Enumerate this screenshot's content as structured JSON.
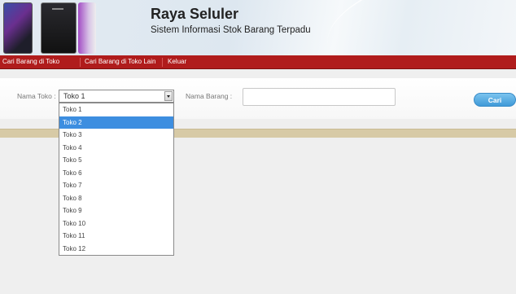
{
  "header": {
    "title": "Raya Seluler",
    "subtitle": "Sistem Informasi Stok Barang Terpadu"
  },
  "nav": {
    "items": [
      "Cari Barang di Toko",
      "Cari Barang di Toko Lain",
      "Keluar"
    ]
  },
  "search": {
    "toko_label": "Nama Toko :",
    "toko_selected": "Toko 1",
    "barang_label": "Nama Barang :",
    "barang_value": "",
    "button_label": "Cari"
  },
  "dropdown": {
    "options": [
      "Toko 1",
      "Toko 2",
      "Toko 3",
      "Toko 4",
      "Toko 5",
      "Toko 6",
      "Toko 7",
      "Toko 8",
      "Toko 9",
      "Toko 10",
      "Toko 11",
      "Toko 12"
    ],
    "highlighted": "Toko 2"
  },
  "colors": {
    "nav_bg": "#b01c1c",
    "button": "#3f9ad8",
    "highlight": "#3d8ee0",
    "bar": "#d7caa6"
  }
}
